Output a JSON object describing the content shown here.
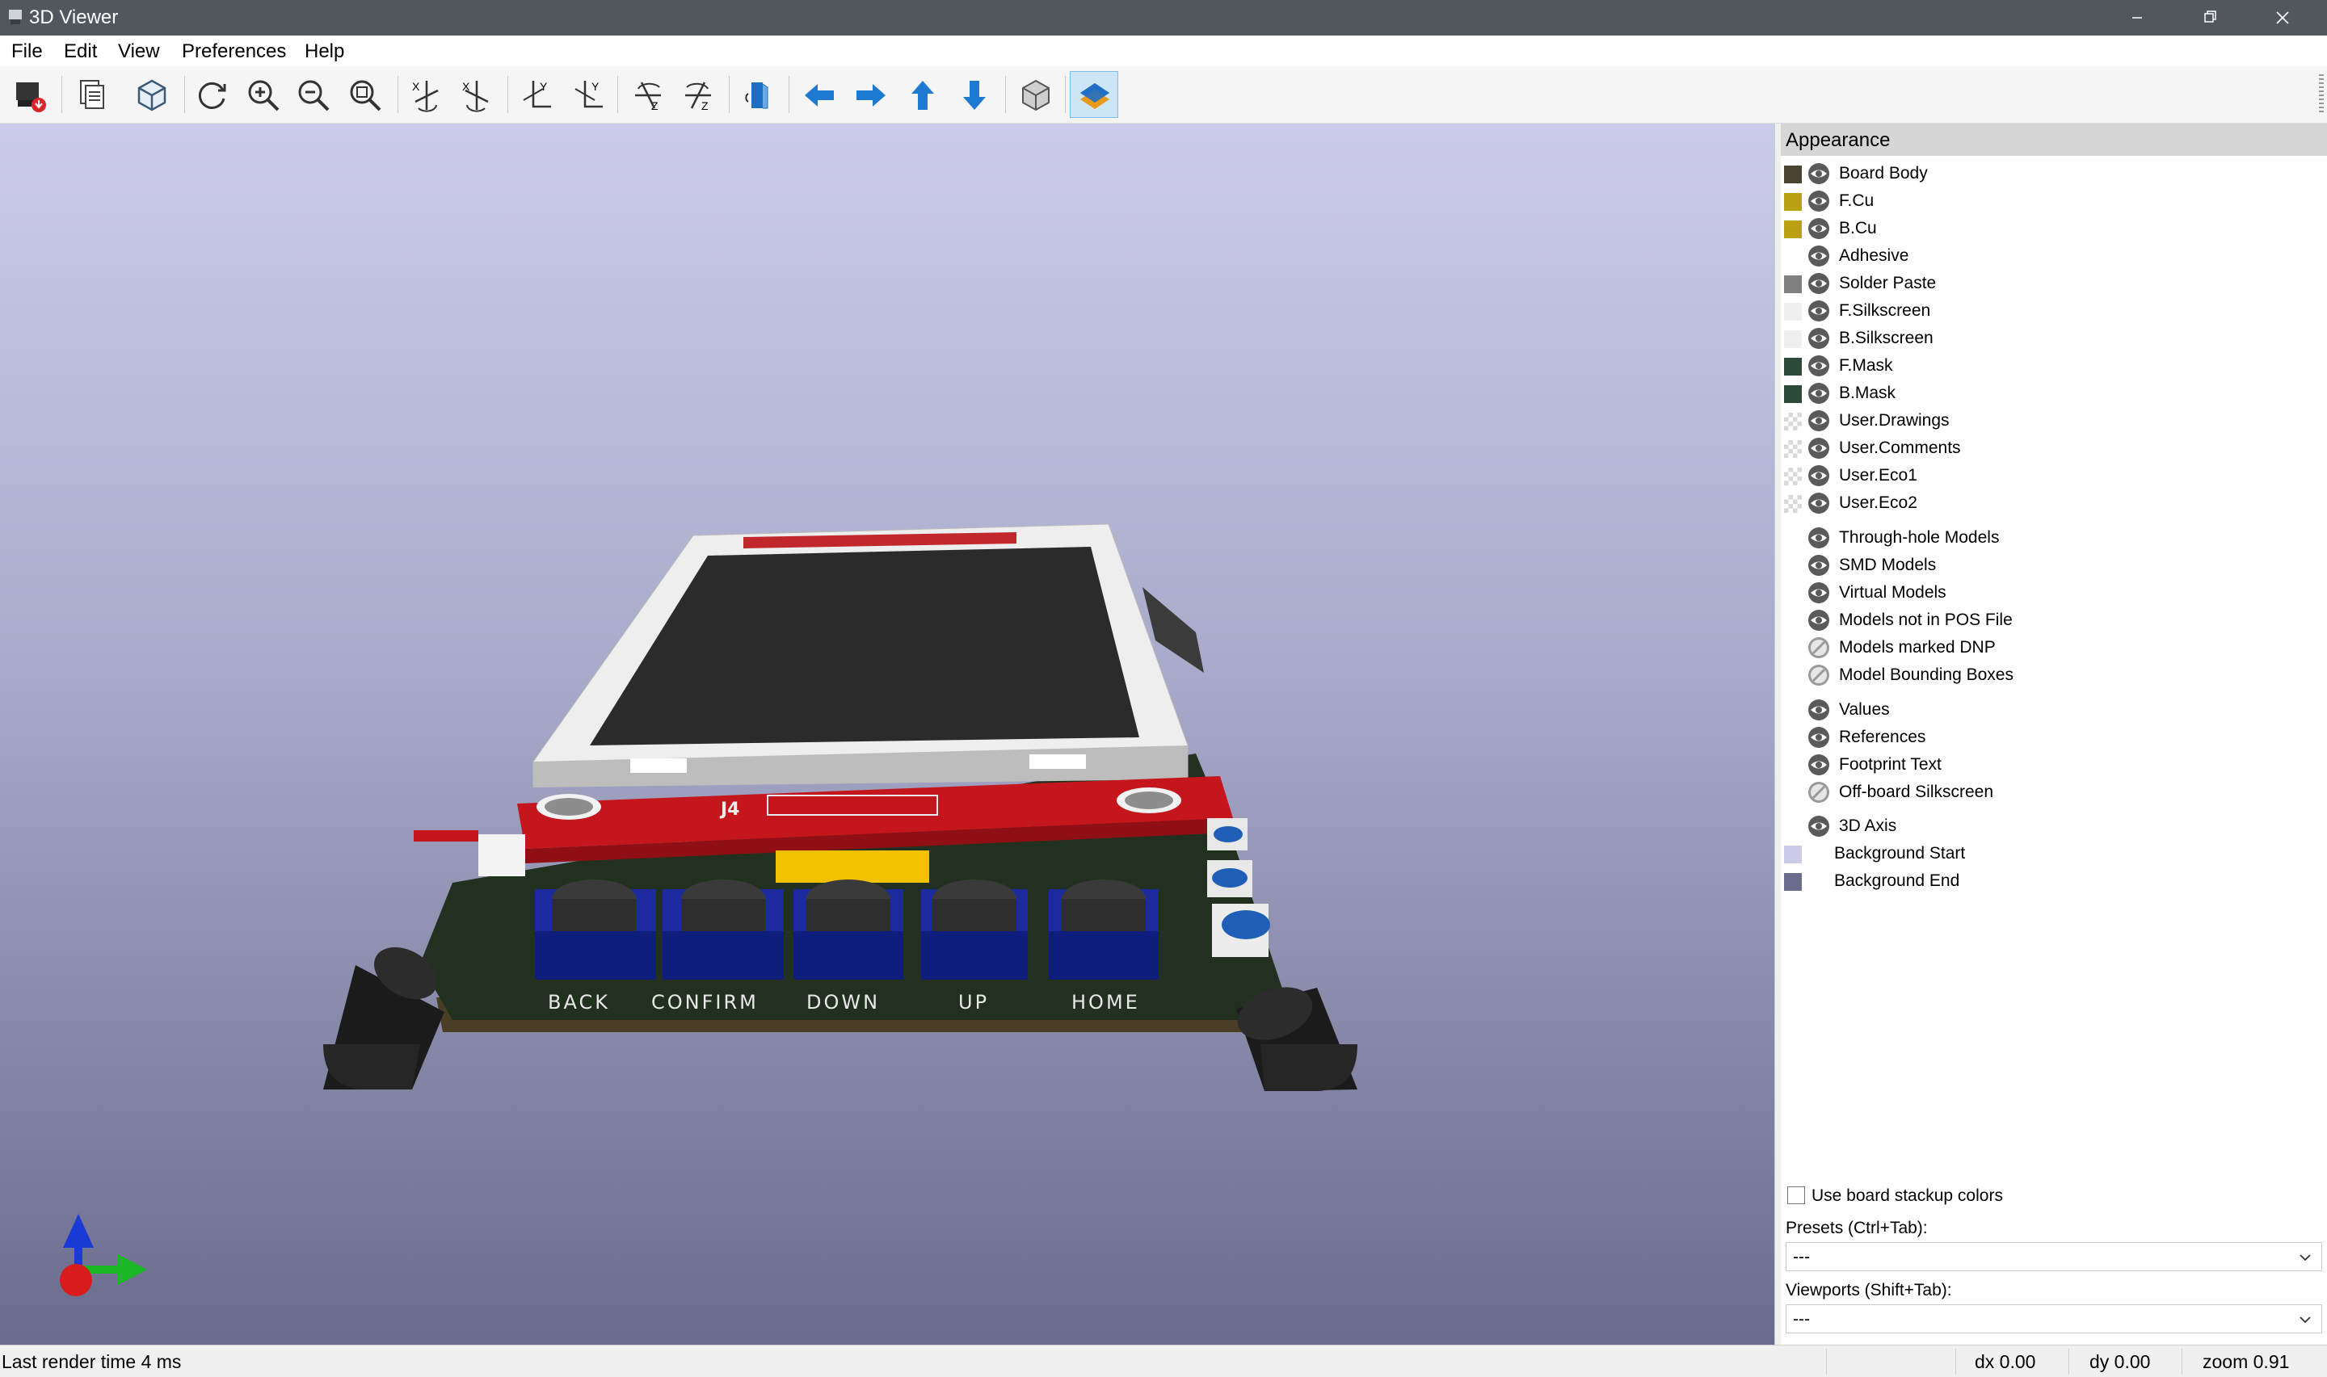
{
  "window": {
    "title": "3D Viewer"
  },
  "menu": [
    "File",
    "Edit",
    "View",
    "Preferences",
    "Help"
  ],
  "toolbar": {
    "buttons": [
      {
        "icon": "export-image-icon",
        "label": "Export image"
      },
      {
        "icon": "copy-to-clipboard-icon",
        "label": "Copy"
      },
      {
        "icon": "raytrace-icon",
        "label": "Render raytracing"
      },
      {
        "icon": "reload-icon",
        "label": "Reload"
      },
      {
        "icon": "zoom-in-icon",
        "label": "Zoom in"
      },
      {
        "icon": "zoom-out-icon",
        "label": "Zoom out"
      },
      {
        "icon": "zoom-fit-icon",
        "label": "Zoom to fit"
      },
      {
        "icon": "rotate-x-cw-icon",
        "label": "Rotate X clockwise"
      },
      {
        "icon": "rotate-x-ccw-icon",
        "label": "Rotate X counterclockwise"
      },
      {
        "icon": "rotate-y-cw-icon",
        "label": "Rotate Y clockwise"
      },
      {
        "icon": "rotate-y-ccw-icon",
        "label": "Rotate Y counterclockwise"
      },
      {
        "icon": "rotate-z-cw-icon",
        "label": "Rotate Z clockwise"
      },
      {
        "icon": "rotate-z-ccw-icon",
        "label": "Rotate Z counterclockwise"
      },
      {
        "icon": "flip-board-icon",
        "label": "Flip board"
      },
      {
        "icon": "pan-left-icon",
        "label": "Pan left"
      },
      {
        "icon": "pan-right-icon",
        "label": "Pan right"
      },
      {
        "icon": "pan-up-icon",
        "label": "Pan up"
      },
      {
        "icon": "pan-down-icon",
        "label": "Pan down"
      },
      {
        "icon": "orthographic-icon",
        "label": "Orthographic"
      },
      {
        "icon": "layers-manager-icon",
        "label": "Appearance manager",
        "active": true
      }
    ]
  },
  "viewport": {
    "board_labels": [
      "BACK",
      "CONFIRM",
      "DOWN",
      "UP",
      "HOME"
    ],
    "connector_ref": "J4",
    "background_start": "#ccccea",
    "background_end": "#6b6b8c"
  },
  "appearance": {
    "title": "Appearance",
    "layers": [
      {
        "name": "Board Body",
        "color": "#4a4331",
        "eye": "visible"
      },
      {
        "name": "F.Cu",
        "color": "#b8a214",
        "eye": "visible"
      },
      {
        "name": "B.Cu",
        "color": "#b8a214",
        "eye": "visible"
      },
      {
        "name": "Adhesive",
        "color": "",
        "eye": "visible"
      },
      {
        "name": "Solder Paste",
        "color": "#808080",
        "eye": "visible"
      },
      {
        "name": "F.Silkscreen",
        "color": "#efefef",
        "eye": "visible"
      },
      {
        "name": "B.Silkscreen",
        "color": "#efefef",
        "eye": "visible"
      },
      {
        "name": "F.Mask",
        "color": "#2c4a3a",
        "eye": "visible"
      },
      {
        "name": "B.Mask",
        "color": "#2c4a3a",
        "eye": "visible"
      },
      {
        "name": "User.Drawings",
        "color": "checker",
        "eye": "visible"
      },
      {
        "name": "User.Comments",
        "color": "checker",
        "eye": "visible"
      },
      {
        "name": "User.Eco1",
        "color": "checker",
        "eye": "visible"
      },
      {
        "name": "User.Eco2",
        "color": "checker",
        "eye": "visible"
      }
    ],
    "models": [
      {
        "name": "Through-hole Models",
        "eye": "visible"
      },
      {
        "name": "SMD Models",
        "eye": "visible"
      },
      {
        "name": "Virtual Models",
        "eye": "visible"
      },
      {
        "name": "Models not in POS File",
        "eye": "visible"
      },
      {
        "name": "Models marked DNP",
        "eye": "hidden"
      },
      {
        "name": "Model Bounding Boxes",
        "eye": "hidden"
      }
    ],
    "text_items": [
      {
        "name": "Values",
        "eye": "visible"
      },
      {
        "name": "References",
        "eye": "visible"
      },
      {
        "name": "Footprint Text",
        "eye": "visible"
      },
      {
        "name": "Off-board Silkscreen",
        "eye": "hidden"
      }
    ],
    "misc": [
      {
        "name": "3D Axis",
        "eye": "visible"
      }
    ],
    "backgrounds": [
      {
        "name": "Background Start",
        "color": "#ccccea"
      },
      {
        "name": "Background End",
        "color": "#6b6b8c"
      }
    ],
    "use_stackup_label": "Use board stackup colors",
    "use_stackup_checked": false,
    "presets_label": "Presets (Ctrl+Tab):",
    "presets_value": "---",
    "viewports_label": "Viewports (Shift+Tab):",
    "viewports_value": "---"
  },
  "status": {
    "render": "Last render time 4 ms",
    "dx": "dx 0.00",
    "dy": "dy 0.00",
    "zoom": "zoom 0.91"
  }
}
